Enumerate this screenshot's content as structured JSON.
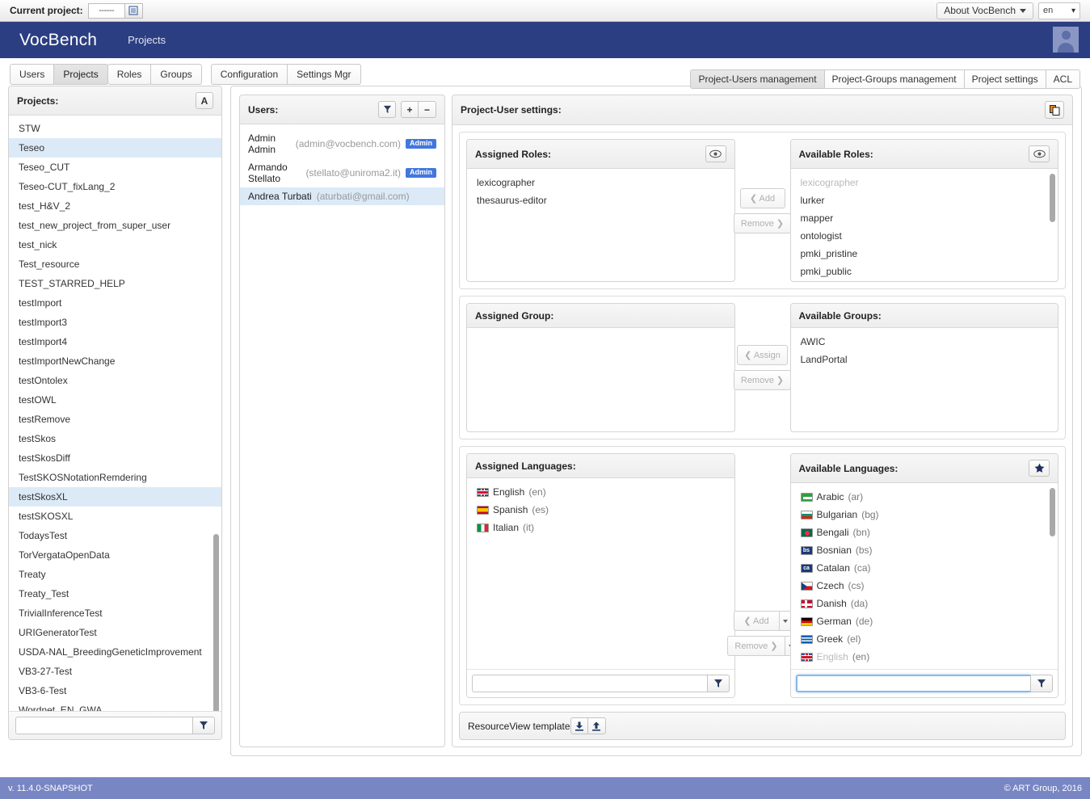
{
  "topbar": {
    "current_project_label": "Current project:",
    "current_project_value": "------",
    "about_label": "About VocBench",
    "language_value": "en"
  },
  "navbar": {
    "brand": "VocBench",
    "section": "Projects"
  },
  "tabs": [
    {
      "label": "Users",
      "active": false
    },
    {
      "label": "Projects",
      "active": true
    },
    {
      "label": "Roles",
      "active": false
    },
    {
      "label": "Groups",
      "active": false
    },
    {
      "label": "Configuration",
      "active": false
    },
    {
      "label": "Settings Mgr",
      "active": false
    }
  ],
  "projects_panel": {
    "title": "Projects:",
    "sort_button": "A",
    "filter_value": "",
    "items": [
      "STW",
      "Teseo",
      "Teseo_CUT",
      "Teseo-CUT_fixLang_2",
      "test_H&V_2",
      "test_new_project_from_super_user",
      "test_nick",
      "Test_resource",
      "TEST_STARRED_HELP",
      "testImport",
      "testImport3",
      "testImport4",
      "testImportNewChange",
      "testOntolex",
      "testOWL",
      "testRemove",
      "testSkos",
      "testSkosDiff",
      "TestSKOSNotationRemdering",
      "testSkosXL",
      "testSKOSXL",
      "TodaysTest",
      "TorVergataOpenData",
      "Treaty",
      "Treaty_Test",
      "TrivialInferenceTest",
      "URIGeneratorTest",
      "USDA-NAL_BreedingGeneticImprovement",
      "VB3-27-Test",
      "VB3-6-Test",
      "Wordnet_EN_GWA"
    ],
    "selected": [
      "Teseo",
      "testSkosXL"
    ]
  },
  "subtabs": [
    {
      "label": "Project-Users management",
      "active": true
    },
    {
      "label": "Project-Groups management",
      "active": false
    },
    {
      "label": "Project settings",
      "active": false
    },
    {
      "label": "ACL",
      "active": false
    }
  ],
  "users_panel": {
    "title": "Users:",
    "users": [
      {
        "name": "Admin Admin",
        "email": "(admin@vocbench.com)",
        "badge": "Admin",
        "selected": false
      },
      {
        "name": "Armando Stellato",
        "email": "(stellato@uniroma2.it)",
        "badge": "Admin",
        "selected": false
      },
      {
        "name": "Andrea Turbati",
        "email": "(aturbati@gmail.com)",
        "badge": "",
        "selected": true
      }
    ]
  },
  "settings": {
    "title": "Project-User settings:",
    "roles": {
      "assigned_title": "Assigned Roles:",
      "available_title": "Available Roles:",
      "assigned": [
        "lexicographer",
        "thesaurus-editor"
      ],
      "available": [
        {
          "label": "lexicographer",
          "dim": true
        },
        {
          "label": "lurker",
          "dim": false
        },
        {
          "label": "mapper",
          "dim": false
        },
        {
          "label": "ontologist",
          "dim": false
        },
        {
          "label": "pmki_pristine",
          "dim": false
        },
        {
          "label": "pmki_public",
          "dim": false
        }
      ],
      "add_label": "Add",
      "remove_label": "Remove"
    },
    "groups": {
      "assigned_title": "Assigned Group:",
      "available_title": "Available Groups:",
      "assigned": [],
      "available": [
        "AWIC",
        "LandPortal"
      ],
      "assign_label": "Assign",
      "remove_label": "Remove"
    },
    "languages": {
      "assigned_title": "Assigned Languages:",
      "available_title": "Available Languages:",
      "assigned": [
        {
          "label": "English",
          "code": "(en)",
          "flag": "en"
        },
        {
          "label": "Spanish",
          "code": "(es)",
          "flag": "es"
        },
        {
          "label": "Italian",
          "code": "(it)",
          "flag": "it"
        }
      ],
      "available": [
        {
          "label": "Arabic",
          "code": "(ar)",
          "flag": "ar",
          "dim": false
        },
        {
          "label": "Bulgarian",
          "code": "(bg)",
          "flag": "bg",
          "dim": false
        },
        {
          "label": "Bengali",
          "code": "(bn)",
          "flag": "bn",
          "dim": false
        },
        {
          "label": "Bosnian",
          "code": "(bs)",
          "flag": "bs",
          "dim": false
        },
        {
          "label": "Catalan",
          "code": "(ca)",
          "flag": "ca",
          "dim": false
        },
        {
          "label": "Czech",
          "code": "(cs)",
          "flag": "cs",
          "dim": false
        },
        {
          "label": "Danish",
          "code": "(da)",
          "flag": "da",
          "dim": false
        },
        {
          "label": "German",
          "code": "(de)",
          "flag": "de",
          "dim": false
        },
        {
          "label": "Greek",
          "code": "(el)",
          "flag": "el",
          "dim": false
        },
        {
          "label": "English",
          "code": "(en)",
          "flag": "en",
          "dim": true
        }
      ],
      "add_label": "Add",
      "remove_label": "Remove",
      "assigned_filter_value": "",
      "available_filter_value": ""
    },
    "resourceview_title": "ResourceView template"
  },
  "footer": {
    "version": "v. 11.4.0-SNAPSHOT",
    "copyright": "© ART Group, 2016"
  }
}
